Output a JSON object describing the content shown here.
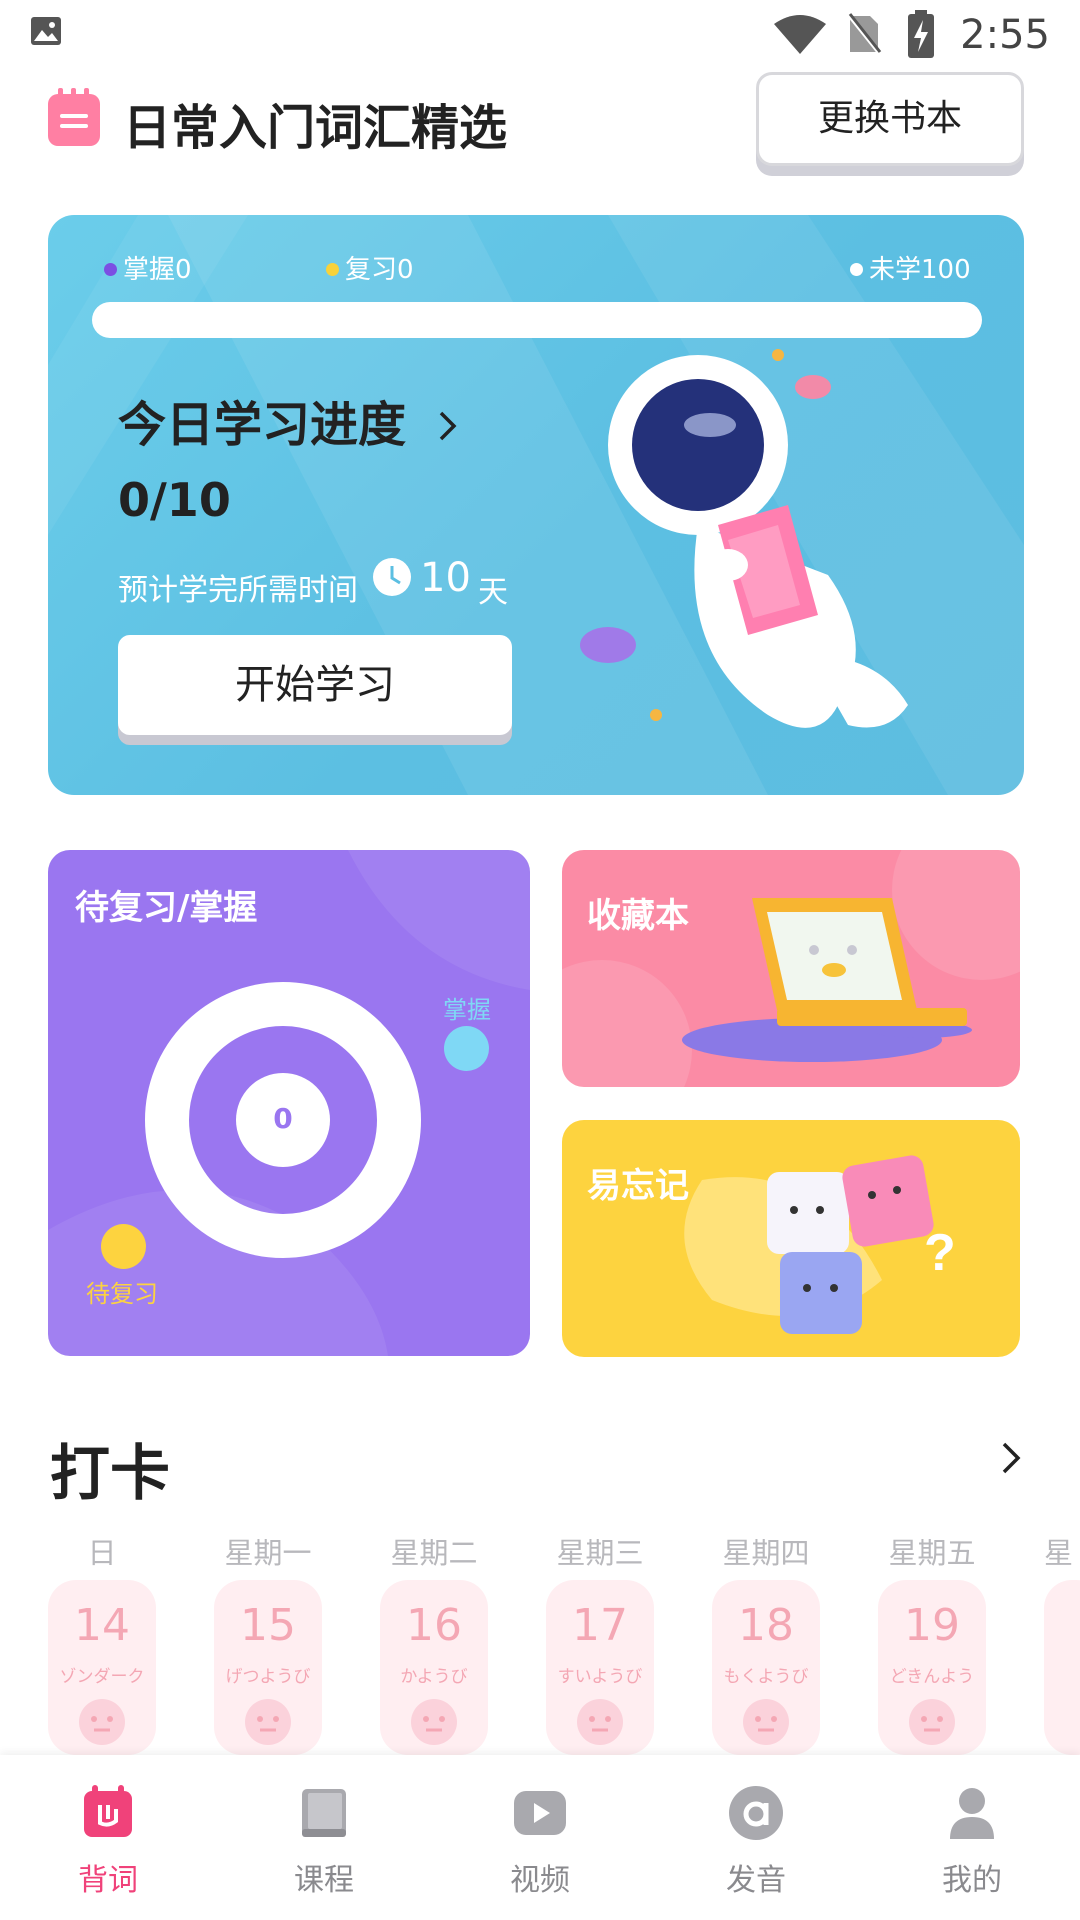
{
  "status_bar": {
    "time": "2:55"
  },
  "header": {
    "book_title": "日常入门词汇精选",
    "change_book_label": "更换书本"
  },
  "progress_card": {
    "mastered_label": "掌握0",
    "review_label": "复习0",
    "unlearned_label": "未学100",
    "progress_fraction": 0,
    "today_title": "今日学习进度",
    "today_count": "0/10",
    "eta_label": "预计学完所需时间",
    "eta_days": "10",
    "eta_unit": "天",
    "start_label": "开始学习"
  },
  "review_card": {
    "title": "待复习/掌握",
    "center_value": "0",
    "mastered_label": "掌握",
    "pending_label": "待复习"
  },
  "favorites_card": {
    "title": "收藏本"
  },
  "forget_card": {
    "title": "易忘记"
  },
  "checkin": {
    "title": "打卡",
    "days": [
      {
        "name": "日",
        "num": "14",
        "kana": "ゾンダーク"
      },
      {
        "name": "星期一",
        "num": "15",
        "kana": "げつようび"
      },
      {
        "name": "星期二",
        "num": "16",
        "kana": "かようび"
      },
      {
        "name": "星期三",
        "num": "17",
        "kana": "すいようび"
      },
      {
        "name": "星期四",
        "num": "18",
        "kana": "もくようび"
      },
      {
        "name": "星期五",
        "num": "19",
        "kana": "どきんよう"
      },
      {
        "name": "星",
        "num": "",
        "kana": ""
      }
    ]
  },
  "bottom_nav": {
    "items": [
      {
        "label": "背词",
        "icon": "word-card-icon"
      },
      {
        "label": "课程",
        "icon": "book-icon"
      },
      {
        "label": "视频",
        "icon": "play-icon"
      },
      {
        "label": "发音",
        "icon": "at-sign-icon"
      },
      {
        "label": "我的",
        "icon": "person-icon"
      }
    ]
  },
  "colors": {
    "accent_pink": "#f0427a",
    "progress_card": "#5cbfe2",
    "review_card": "#9a76f0",
    "favorites_card": "#fb8ba5",
    "forget_card": "#fdd33f"
  }
}
